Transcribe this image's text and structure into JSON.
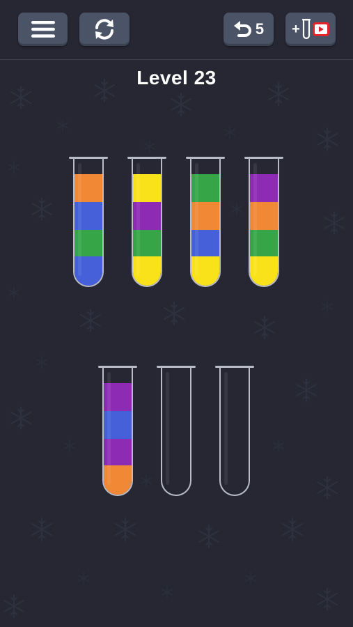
{
  "header": {
    "menu_icon": "hamburger-menu-icon",
    "restart_icon": "restart-arrows-icon",
    "undo_icon": "undo-arrow-icon",
    "undo_count": "5",
    "add_tube_plus": "+",
    "add_tube_icon": "test-tube-icon",
    "video_ad_icon": "video-play-icon"
  },
  "level_title": "Level 23",
  "colors": {
    "orange": "#f08836",
    "blue": "#4560d8",
    "green": "#35a547",
    "yellow": "#fae21b",
    "purple": "#8e2bb5",
    "tube_border": "#b9bcc6",
    "background": "#262733",
    "button": "#4a5466",
    "video_red": "#e3242b"
  },
  "tubes": [
    {
      "segments_top_to_bottom": [
        "orange",
        "blue",
        "green",
        "blue"
      ]
    },
    {
      "segments_top_to_bottom": [
        "yellow",
        "purple",
        "green",
        "yellow"
      ]
    },
    {
      "segments_top_to_bottom": [
        "green",
        "orange",
        "blue",
        "yellow"
      ]
    },
    {
      "segments_top_to_bottom": [
        "purple",
        "orange",
        "green",
        "yellow"
      ]
    },
    {
      "segments_top_to_bottom": [
        "purple",
        "blue",
        "purple",
        "orange"
      ]
    },
    {
      "segments_top_to_bottom": []
    },
    {
      "segments_top_to_bottom": []
    }
  ]
}
